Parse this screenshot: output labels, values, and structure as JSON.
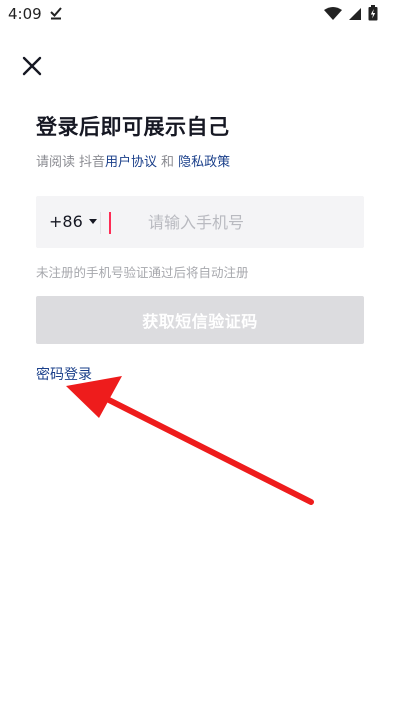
{
  "status_bar": {
    "time": "4:09",
    "icons": [
      "download-done-icon",
      "wifi-icon",
      "signal-icon",
      "battery-charging-icon"
    ]
  },
  "header": {
    "close_icon": "close-icon"
  },
  "title": "登录后即可展示自己",
  "agreement": {
    "prefix": "请阅读",
    "app_name": "抖音",
    "user_agreement": "用户协议",
    "and": "和",
    "privacy_policy": "隐私政策"
  },
  "phone": {
    "country_code": "+86",
    "placeholder": "请输入手机号",
    "value": ""
  },
  "hint": "未注册的手机号验证通过后将自动注册",
  "sms_button_label": "获取短信验证码",
  "password_login_label": "密码登录",
  "colors": {
    "link": "#1a3f8a",
    "cursor": "#fe2c55",
    "button_disabled": "#dcdcdf",
    "input_bg": "#f4f4f6",
    "annotation_arrow": "#ee1c1c"
  }
}
